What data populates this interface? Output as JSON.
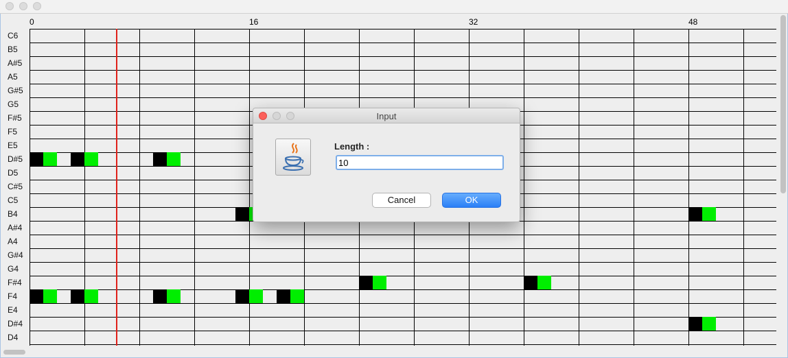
{
  "ruler": {
    "labels": [
      "0",
      "16",
      "32",
      "48"
    ]
  },
  "notes": [
    "C6",
    "B5",
    "A#5",
    "A5",
    "G#5",
    "G5",
    "F#5",
    "F5",
    "E5",
    "D#5",
    "D5",
    "C#5",
    "C5",
    "B4",
    "A#4",
    "A4",
    "G#4",
    "G4",
    "F#4",
    "F4",
    "E4",
    "D#4",
    "D4"
  ],
  "dialog": {
    "title": "Input",
    "prompt": "Length :",
    "value": "10",
    "cancel_label": "Cancel",
    "ok_label": "OK"
  },
  "colors": {
    "note_head": "#000000",
    "note_tail": "#00ee00",
    "playhead": "#e0201a",
    "ok_button": "#2a7ff6"
  },
  "icons": {
    "dialog_icon": "java-coffee-cup-icon"
  }
}
